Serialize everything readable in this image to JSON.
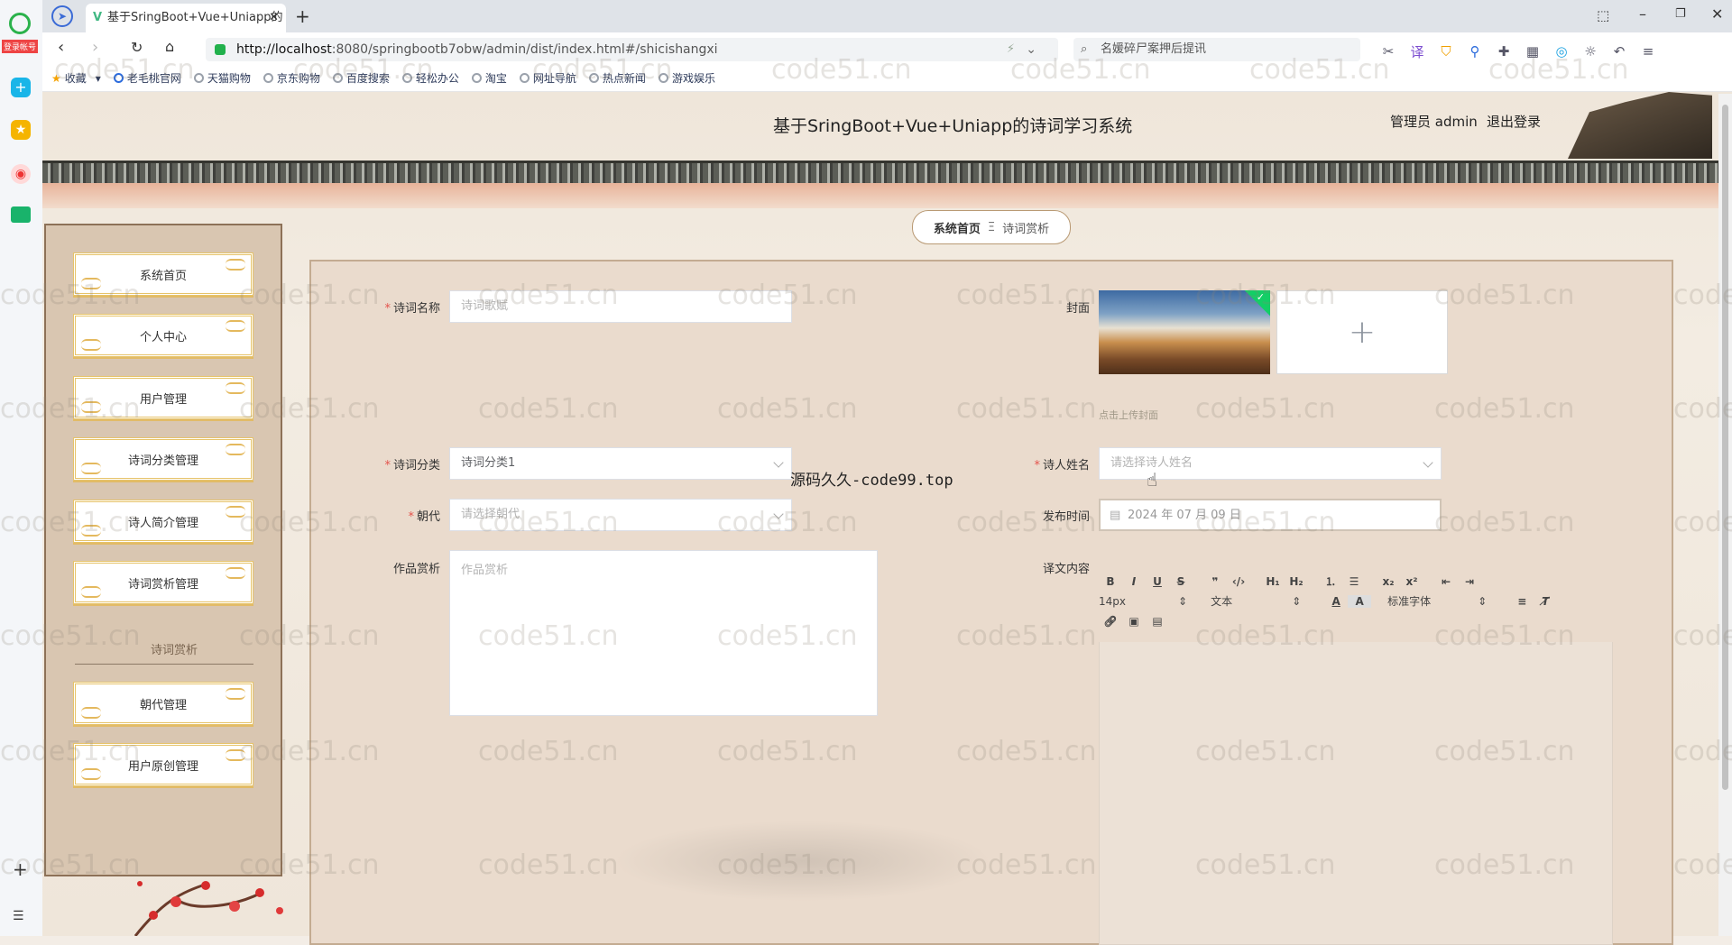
{
  "browser": {
    "tab_title": "基于SringBoot+Vue+Uniapp的",
    "url_prefix": "http://localhost",
    "url_rest": ":8080/springbootb7obw/admin/dist/index.html#/shicishangxi",
    "search_placeholder": "名媛碎尸案押后提讯",
    "login_badge": "登录帐号",
    "bookmarks": [
      "收藏",
      "老毛桃官网",
      "天猫购物",
      "京东购物",
      "百度搜索",
      "轻松办公",
      "淘宝",
      "网址导航",
      "热点新闻",
      "游戏娱乐"
    ]
  },
  "header": {
    "title": "基于SringBoot+Vue+Uniapp的诗词学习系统",
    "admin_label": "管理员 admin",
    "logout": "退出登录"
  },
  "breadcrumb": {
    "home": "系统首页",
    "separator": "Ξ",
    "current": "诗词赏析"
  },
  "sidebar": {
    "items": [
      "系统首页",
      "个人中心",
      "用户管理",
      "诗词分类管理",
      "诗人简介管理",
      "诗词赏析管理"
    ],
    "group_label": "诗词赏析",
    "items2": [
      "朝代管理",
      "用户原创管理"
    ]
  },
  "form": {
    "title_label": "诗词名称",
    "title_placeholder": "诗词歌赋",
    "cover_label": "封面",
    "cover_hint": "点击上传封面",
    "category_label": "诗词分类",
    "category_value": "诗词分类1",
    "poet_label": "诗人姓名",
    "poet_placeholder": "请选择诗人姓名",
    "dynasty_label": "朝代",
    "dynasty_placeholder": "请选择朝代",
    "date_label": "发布时间",
    "date_value": "2024 年 07 月 09 日",
    "appreciation_label": "作品赏析",
    "appreciation_placeholder": "作品赏析",
    "translation_label": "译文内容",
    "editor": {
      "font_size": "14px",
      "block_type": "文本",
      "font_family": "标准字体"
    }
  },
  "overlay_text": "源码久久-code99.top",
  "watermark": "code51.cn"
}
